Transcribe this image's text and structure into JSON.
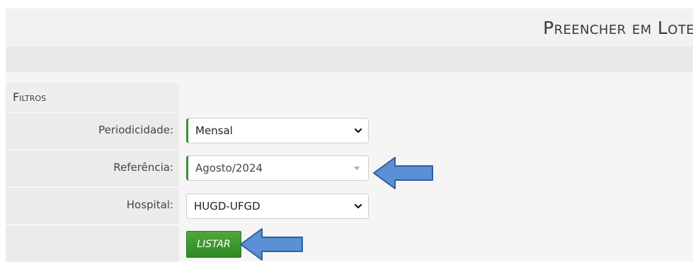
{
  "header": {
    "title": "Preencher em Lote"
  },
  "filters": {
    "title": "Filtros",
    "periodicidade": {
      "label": "Periodicidade:",
      "value": "Mensal"
    },
    "referencia": {
      "label": "Referência:",
      "value": "Agosto/2024"
    },
    "hospital": {
      "label": "Hospital:",
      "value": "HUGD-UFGD"
    }
  },
  "actions": {
    "listar_label": "LISTAR"
  },
  "colors": {
    "accent_green": "#3f8f3a",
    "arrow_blue": "#5b8fd6"
  },
  "icons": {
    "select_chevron": "chevron-down-icon",
    "annotation": "arrow-left-icon"
  }
}
